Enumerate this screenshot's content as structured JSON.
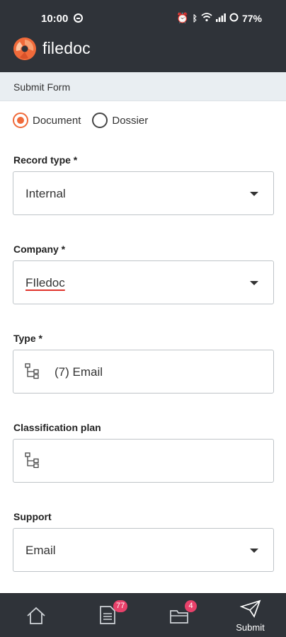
{
  "status_bar": {
    "time": "10:00",
    "battery": "77%"
  },
  "app": {
    "name": "filedoc",
    "brand_color": "#f06a3a",
    "header_color": "#2f3339"
  },
  "section": {
    "title": "Submit Form"
  },
  "radio": {
    "options": [
      {
        "label": "Document",
        "selected": true
      },
      {
        "label": "Dossier",
        "selected": false
      }
    ]
  },
  "fields": {
    "record_type": {
      "label": "Record type *",
      "value": "Internal"
    },
    "company": {
      "label": "Company *",
      "value": "FIledoc"
    },
    "type": {
      "label": "Type *",
      "value": "(7) Email"
    },
    "classification_plan": {
      "label": "Classification plan",
      "value": ""
    },
    "support": {
      "label": "Support",
      "value": "Email"
    }
  },
  "bottom_nav": {
    "items": [
      {
        "name": "home",
        "icon": "home-icon"
      },
      {
        "name": "documents",
        "icon": "document-icon",
        "badge": "77"
      },
      {
        "name": "folders",
        "icon": "folder-icon",
        "badge": "4"
      },
      {
        "name": "submit",
        "icon": "send-icon",
        "label": "Submit"
      }
    ],
    "badge_color": "#e8416a"
  }
}
